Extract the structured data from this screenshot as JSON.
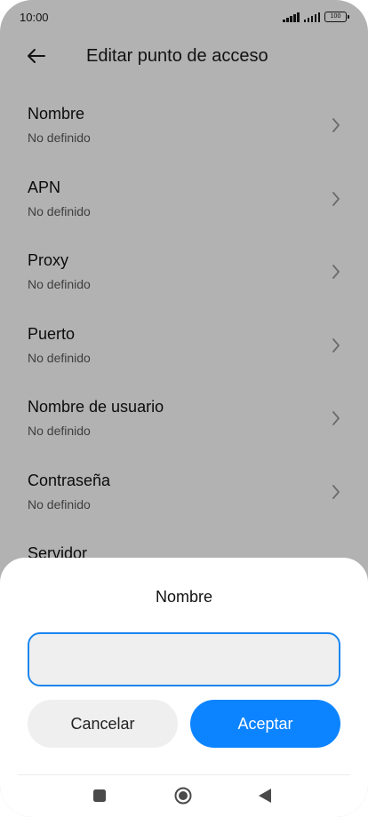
{
  "status_bar": {
    "time": "10:00",
    "battery": "100"
  },
  "header": {
    "title": "Editar punto de acceso",
    "back_icon": "arrow-left-icon"
  },
  "settings_list": [
    {
      "title": "Nombre",
      "value": "No definido"
    },
    {
      "title": "APN",
      "value": "No definido"
    },
    {
      "title": "Proxy",
      "value": "No definido"
    },
    {
      "title": "Puerto",
      "value": "No definido"
    },
    {
      "title": "Nombre de usuario",
      "value": "No definido"
    },
    {
      "title": "Contraseña",
      "value": "No definido"
    },
    {
      "title": "Servidor",
      "value": ""
    }
  ],
  "dialog": {
    "title": "Nombre",
    "input_value": "",
    "cancel_label": "Cancelar",
    "accept_label": "Aceptar"
  },
  "colors": {
    "accent": "#0d84ff",
    "input_border": "#1a86f0",
    "secondary_button": "#efefef",
    "overlay": "rgba(0,0,0,0.30)"
  },
  "nav_bar": {
    "icons": [
      "recent-apps-icon",
      "home-icon",
      "back-icon"
    ]
  }
}
